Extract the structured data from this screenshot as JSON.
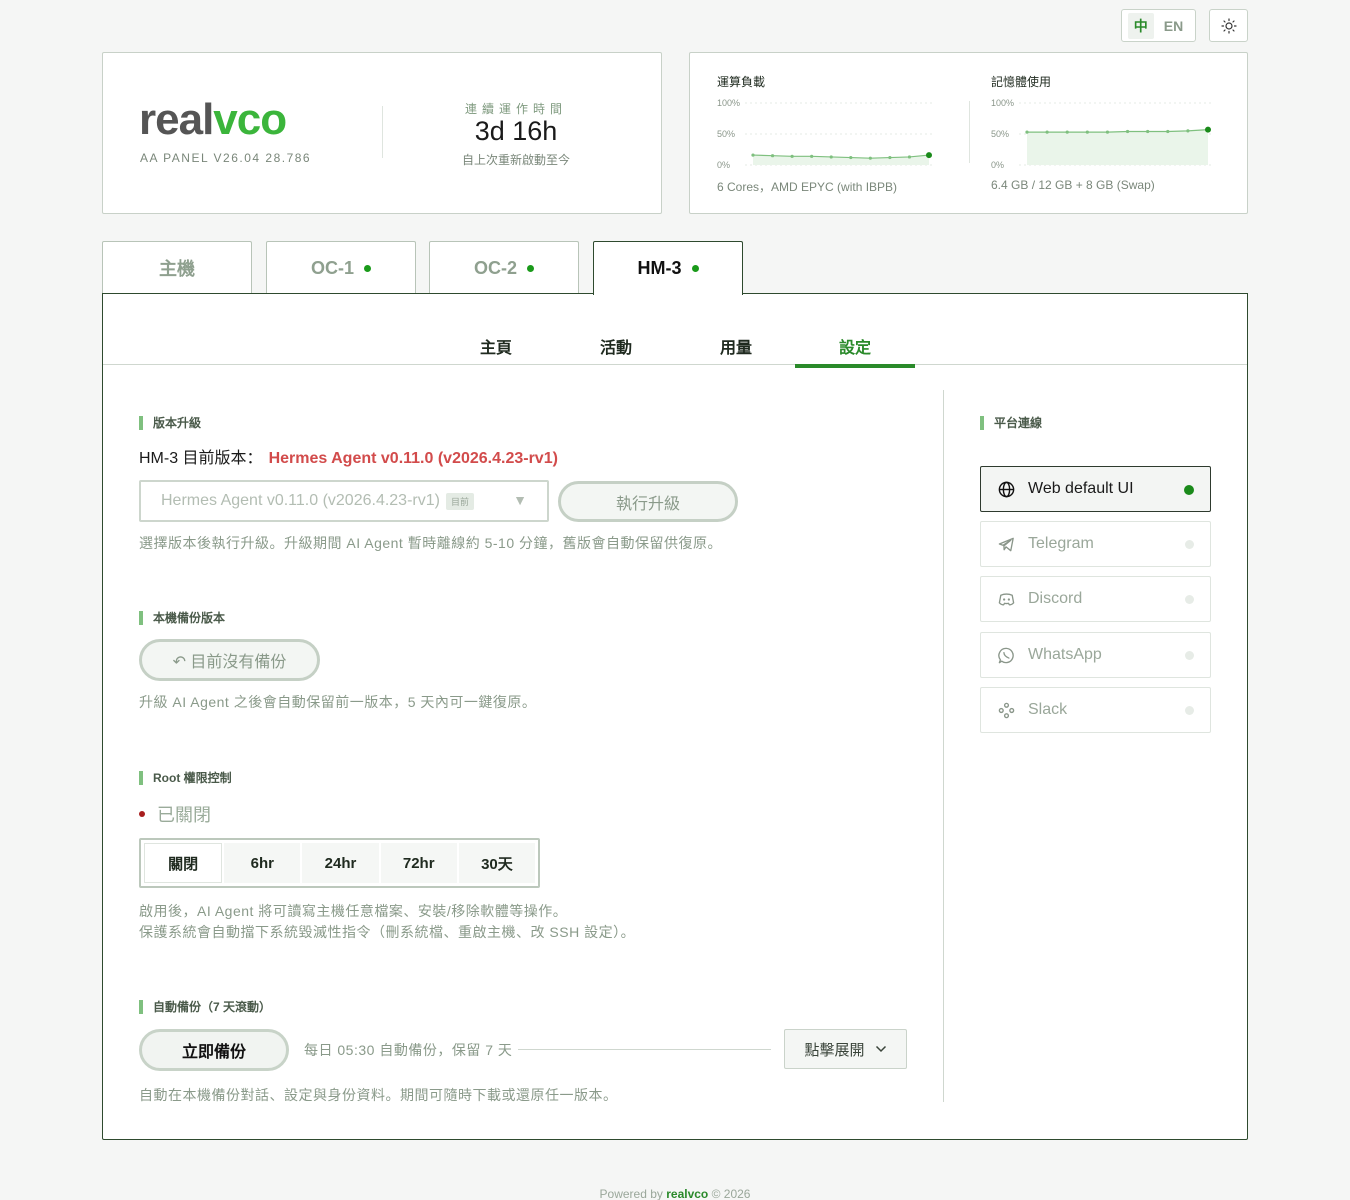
{
  "lang": {
    "zh": "中",
    "en": "EN"
  },
  "brand": {
    "logo_a": "real",
    "logo_b": "vco",
    "panel_version": "AA PANEL V26.04 28.786"
  },
  "uptime": {
    "label": "連續運作時間",
    "value": "3d 16h",
    "sub": "自上次重新啟動至今"
  },
  "stats": {
    "cpu": {
      "title": "運算負載",
      "sub": "6 Cores，AMD EPYC (with IBPB)",
      "ticks": [
        "100%",
        "50%",
        "0%"
      ]
    },
    "mem": {
      "title": "記憶體使用",
      "sub": "6.4 GB / 12 GB + 8 GB (Swap)",
      "ticks": [
        "100%",
        "50%",
        "0%"
      ]
    }
  },
  "chart_data": [
    {
      "type": "line",
      "title": "運算負載",
      "ylim": [
        0,
        100
      ],
      "y_ticks": [
        "0%",
        "50%",
        "100%"
      ],
      "series": [
        {
          "values": [
            16,
            15,
            14,
            14,
            13,
            12,
            11,
            12,
            13,
            16
          ]
        }
      ]
    },
    {
      "type": "line",
      "title": "記憶體使用",
      "ylim": [
        0,
        100
      ],
      "y_ticks": [
        "0%",
        "50%",
        "100%"
      ],
      "series": [
        {
          "values": [
            53,
            53,
            53,
            53,
            53,
            54,
            54,
            54,
            55,
            57
          ]
        }
      ]
    }
  ],
  "host_tabs": [
    {
      "label": "主機",
      "online": false
    },
    {
      "label": "OC-1",
      "online": true
    },
    {
      "label": "OC-2",
      "online": true
    },
    {
      "label": "HM-3",
      "online": true,
      "active": true
    }
  ],
  "sub_tabs": [
    {
      "label": "主頁"
    },
    {
      "label": "活動"
    },
    {
      "label": "用量"
    },
    {
      "label": "設定",
      "active": true
    }
  ],
  "upgrade": {
    "heading": "版本升級",
    "current_label": "HM-3 目前版本：",
    "current_version": "Hermes Agent v0.11.0 (v2026.4.23-rv1)",
    "select_value": "Hermes Agent v0.11.0 (v2026.4.23-rv1)",
    "select_tag": "目前",
    "button": "執行升級",
    "note": "選擇版本後執行升級。升級期間 AI Agent 暫時離線約 5-10 分鐘，舊版會自動保留供復原。"
  },
  "backup_version": {
    "heading": "本機備份版本",
    "button": "↶ 目前沒有備份",
    "note": "升級 AI Agent 之後會自動保留前一版本，5 天內可一鍵復原。"
  },
  "root": {
    "heading": "Root 權限控制",
    "status": "已關閉",
    "options": [
      "關閉",
      "6hr",
      "24hr",
      "72hr",
      "30天"
    ],
    "selected": 0,
    "note1": "啟用後，AI Agent 將可讀寫主機任意檔案、安裝/移除軟體等操作。",
    "note2": "保護系統會自動擋下系統毀滅性指令（刪系統檔、重啟主機、改 SSH 設定）。"
  },
  "auto_backup": {
    "heading": "自動備份（7 天滾動）",
    "button": "立即備份",
    "schedule": "每日 05:30 自動備份，保留 7 天",
    "expand": "點擊展開",
    "note": "自動在本機備份對話、設定與身份資料。期間可隨時下載或還原任一版本。"
  },
  "platforms": {
    "heading": "平台連線",
    "items": [
      {
        "label": "Web default UI",
        "icon": "globe-icon",
        "active": true
      },
      {
        "label": "Telegram",
        "icon": "telegram-icon",
        "active": false
      },
      {
        "label": "Discord",
        "icon": "discord-icon",
        "active": false
      },
      {
        "label": "WhatsApp",
        "icon": "whatsapp-icon",
        "active": false
      },
      {
        "label": "Slack",
        "icon": "slack-icon",
        "active": false
      }
    ]
  },
  "footer": {
    "prefix": "Powered by",
    "brand": "realvco",
    "suffix": "© 2026"
  },
  "colors": {
    "accent": "#2a8a2a",
    "online": "#1a9a1a",
    "danger": "#d24b4b",
    "chart_line": "#7fc07f"
  }
}
